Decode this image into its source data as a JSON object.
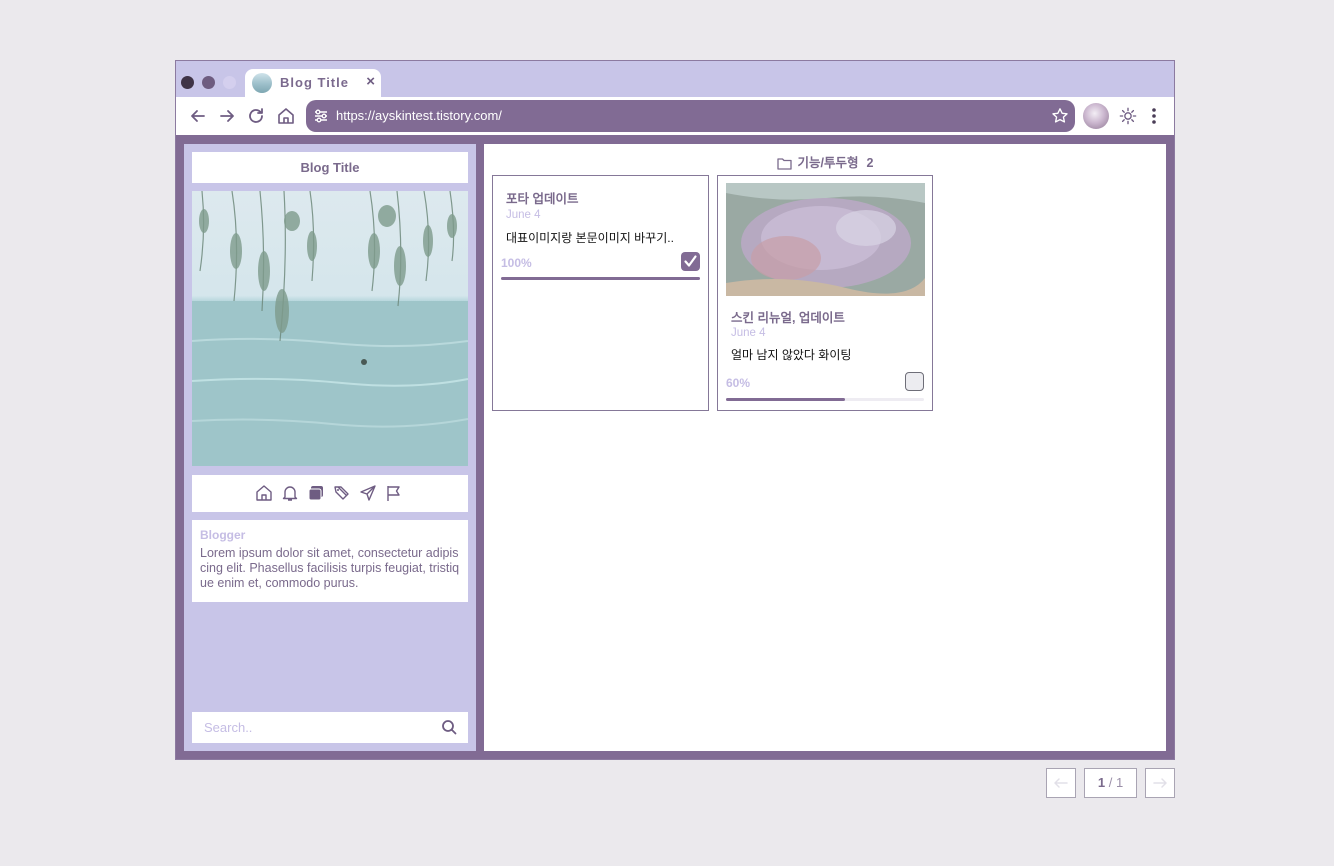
{
  "browser": {
    "tab_title": "Blog Title",
    "tab_close": "×",
    "url": "https://ayskintest.tistory.com/",
    "traffic_dots": [
      "#3f3346",
      "#6e5c80",
      "#d4cfee"
    ]
  },
  "sidebar": {
    "title": "Blog Title",
    "icons": [
      "home-icon",
      "bell-icon",
      "folders-icon",
      "tags-icon",
      "send-icon",
      "flag-icon"
    ],
    "blogger_label": "Blogger",
    "bio": "Lorem ipsum dolor sit amet, consectetur adipiscing elit. Phasellus facilisis turpis feugiat, tristique enim et, commodo purus.",
    "search_placeholder": "Search.."
  },
  "main": {
    "category": "기능/투두형",
    "category_count": "2",
    "cards": [
      {
        "title": "포타 업데이트",
        "date": "June 4",
        "desc": "대표이미지랑 본문이미지 바꾸기..",
        "percent_label": "100%",
        "progress": 1.0,
        "checked": true,
        "has_thumb": false
      },
      {
        "title": "스킨 리뉴얼, 업데이트",
        "date": "June 4",
        "desc": "얼마 남지 않았다 화이팅",
        "percent_label": "60%",
        "progress": 0.6,
        "checked": false,
        "has_thumb": true
      }
    ]
  },
  "pagination": {
    "current": "1",
    "separator": "/",
    "total": "1"
  },
  "colors": {
    "accent": "#816b94",
    "lavender": "#c8c5e8",
    "page_bg": "#ebe9ed"
  }
}
